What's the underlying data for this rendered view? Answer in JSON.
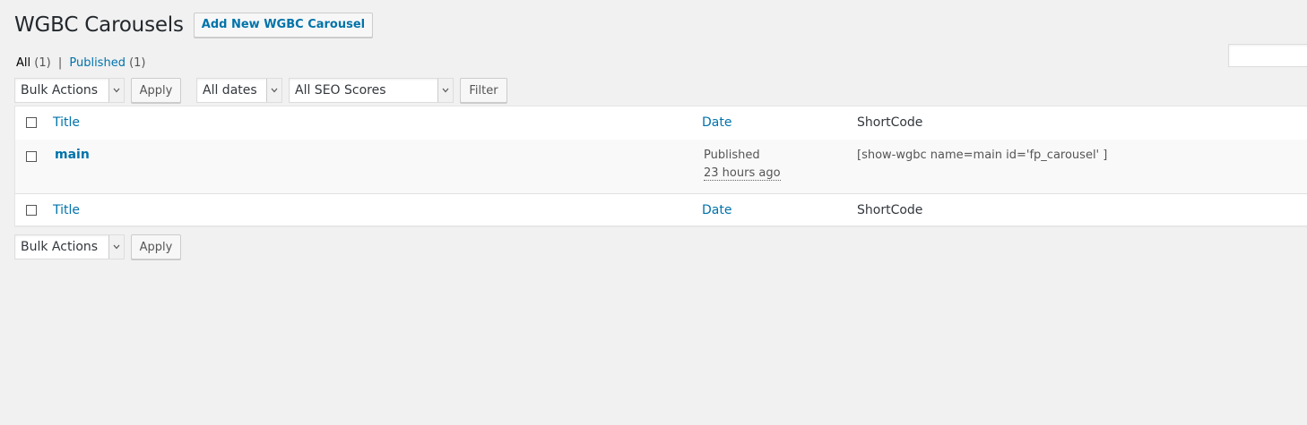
{
  "header": {
    "title": "WGBC Carousels",
    "add_new_label": "Add New WGBC Carousel"
  },
  "views": {
    "all_label": "All",
    "all_count": "(1)",
    "separator": "|",
    "published_label": "Published",
    "published_count": "(1)"
  },
  "top_nav": {
    "bulk_actions": "Bulk Actions",
    "apply_label": "Apply",
    "dates_filter": "All dates",
    "seo_filter": "All SEO Scores",
    "filter_label": "Filter"
  },
  "table": {
    "columns": {
      "title": "Title",
      "date": "Date",
      "shortcode": "ShortCode"
    },
    "rows": [
      {
        "title": "main",
        "status": "Published",
        "date": "23 hours ago",
        "shortcode": "[show-wgbc name=main id='fp_carousel' ]"
      }
    ]
  },
  "bottom_nav": {
    "bulk_actions": "Bulk Actions",
    "apply_label": "Apply"
  },
  "colors": {
    "link": "#0073aa",
    "background": "#f1f1f1",
    "table_bg": "#ffffff",
    "alt_row": "#f9f9f9"
  }
}
